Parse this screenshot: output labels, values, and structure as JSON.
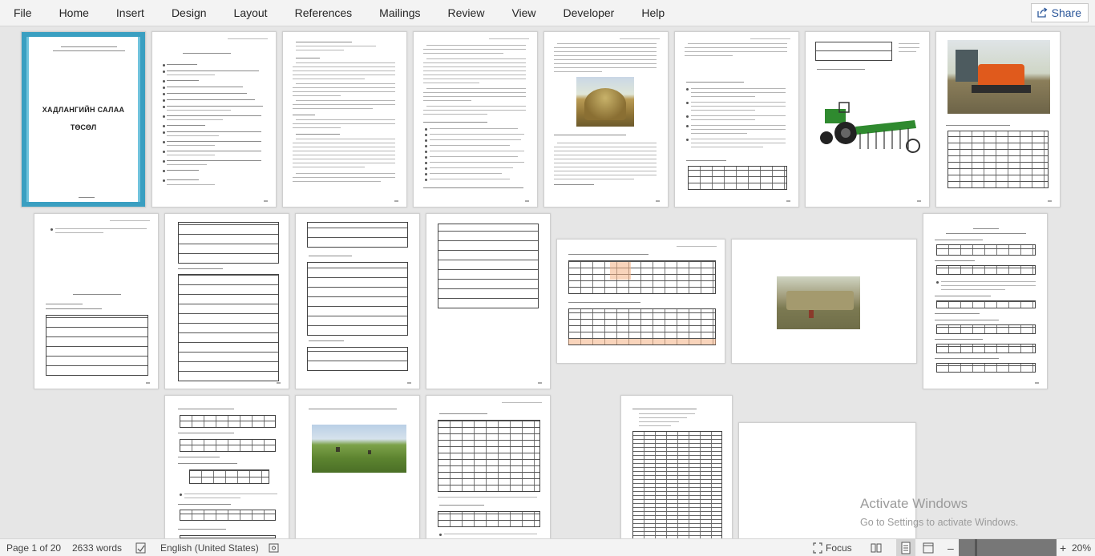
{
  "ribbon": {
    "tabs": [
      "File",
      "Home",
      "Insert",
      "Design",
      "Layout",
      "References",
      "Mailings",
      "Review",
      "View",
      "Developer",
      "Help"
    ],
    "share_label": "Share"
  },
  "cover": {
    "title": "ХАДЛАНГИЙН САЛАА",
    "subtitle": "ТӨСӨЛ"
  },
  "status": {
    "page": "Page 1 of 20",
    "words": "2633 words",
    "language": "English (United States)",
    "focus": "Focus",
    "zoom": "20%"
  },
  "watermark": {
    "line1": "Activate Windows",
    "line2": "Go to Settings to activate Windows."
  }
}
